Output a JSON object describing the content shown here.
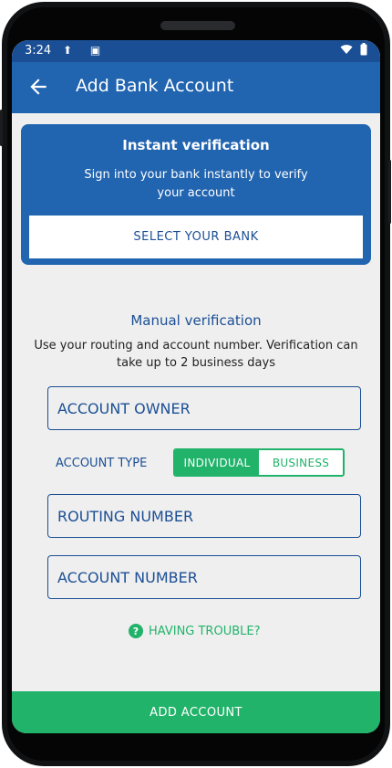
{
  "status": {
    "time": "3:24",
    "left_icons": [
      "upload-icon",
      "sim-card-icon"
    ],
    "right_icons": [
      "wifi-icon",
      "battery-icon"
    ]
  },
  "appbar": {
    "title": "Add Bank Account",
    "back_icon": "arrow-back-icon"
  },
  "instant": {
    "title": "Instant verification",
    "description": "Sign into your bank instantly to verify your account",
    "button_label": "SELECT YOUR BANK"
  },
  "manual": {
    "title": "Manual verification",
    "description": "Use your routing and account number. Verification can take up to 2 business days",
    "account_owner_placeholder": "ACCOUNT OWNER",
    "account_type_label": "ACCOUNT TYPE",
    "account_type_options": [
      "INDIVIDUAL",
      "BUSINESS"
    ],
    "account_type_selected": "INDIVIDUAL",
    "routing_number_placeholder": "ROUTING NUMBER",
    "account_number_placeholder": "ACCOUNT NUMBER"
  },
  "help": {
    "label": "HAVING TROUBLE?",
    "icon": "question-circle-icon"
  },
  "footer": {
    "add_account_label": "ADD ACCOUNT"
  },
  "colors": {
    "primary_blue": "#2164b0",
    "dark_blue": "#1b4f95",
    "accent_green": "#21b36a",
    "background": "#efefef"
  }
}
